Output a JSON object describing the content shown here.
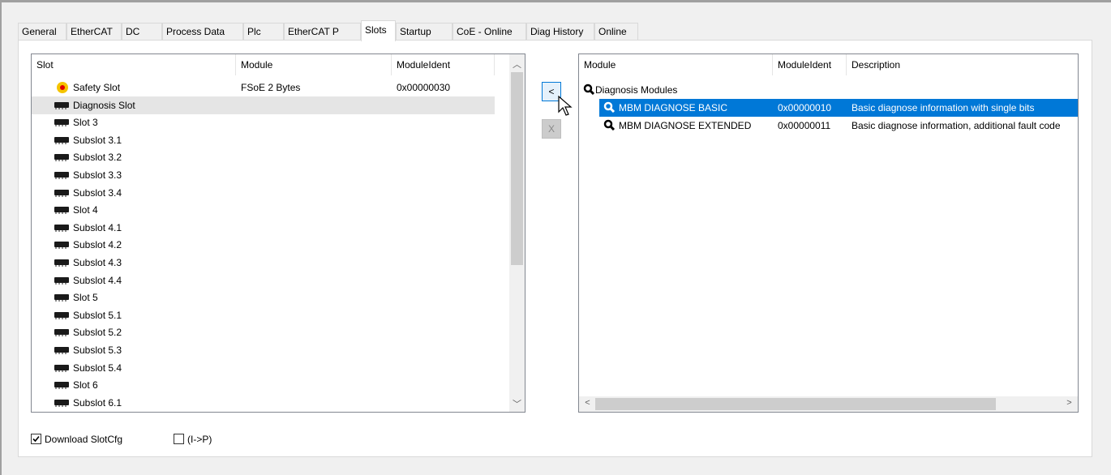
{
  "tabs": [
    "General",
    "EtherCAT",
    "DC",
    "Process Data",
    "Plc",
    "EtherCAT P",
    "Slots",
    "Startup",
    "CoE - Online",
    "Diag History",
    "Online"
  ],
  "active_tab": "Slots",
  "slot_list": {
    "columns": [
      "Slot",
      "Module",
      "ModuleIdent"
    ],
    "rows": [
      {
        "slot": "Safety Slot",
        "module": "FSoE 2 Bytes",
        "ident": "0x00000030",
        "icon": "safety-icon"
      },
      {
        "slot": "Diagnosis Slot",
        "module": "",
        "ident": "",
        "icon": "module-icon"
      },
      {
        "slot": "Slot 3",
        "module": "",
        "ident": "",
        "icon": "module-icon"
      },
      {
        "slot": "Subslot 3.1",
        "module": "",
        "ident": "",
        "icon": "module-icon"
      },
      {
        "slot": "Subslot 3.2",
        "module": "",
        "ident": "",
        "icon": "module-icon"
      },
      {
        "slot": "Subslot 3.3",
        "module": "",
        "ident": "",
        "icon": "module-icon"
      },
      {
        "slot": "Subslot 3.4",
        "module": "",
        "ident": "",
        "icon": "module-icon"
      },
      {
        "slot": "Slot 4",
        "module": "",
        "ident": "",
        "icon": "module-icon"
      },
      {
        "slot": "Subslot 4.1",
        "module": "",
        "ident": "",
        "icon": "module-icon"
      },
      {
        "slot": "Subslot 4.2",
        "module": "",
        "ident": "",
        "icon": "module-icon"
      },
      {
        "slot": "Subslot 4.3",
        "module": "",
        "ident": "",
        "icon": "module-icon"
      },
      {
        "slot": "Subslot 4.4",
        "module": "",
        "ident": "",
        "icon": "module-icon"
      },
      {
        "slot": "Slot 5",
        "module": "",
        "ident": "",
        "icon": "module-icon"
      },
      {
        "slot": "Subslot 5.1",
        "module": "",
        "ident": "",
        "icon": "module-icon"
      },
      {
        "slot": "Subslot 5.2",
        "module": "",
        "ident": "",
        "icon": "module-icon"
      },
      {
        "slot": "Subslot 5.3",
        "module": "",
        "ident": "",
        "icon": "module-icon"
      },
      {
        "slot": "Subslot 5.4",
        "module": "",
        "ident": "",
        "icon": "module-icon"
      },
      {
        "slot": "Slot 6",
        "module": "",
        "ident": "",
        "icon": "module-icon"
      },
      {
        "slot": "Subslot 6.1",
        "module": "",
        "ident": "",
        "icon": "module-icon"
      }
    ],
    "selected_row": "Diagnosis Slot"
  },
  "buttons": {
    "insert_label": "<",
    "remove_label": "X"
  },
  "module_list": {
    "columns": [
      "Module",
      "ModuleIdent",
      "Description"
    ],
    "group": "Diagnosis Modules",
    "rows": [
      {
        "module": "MBM DIAGNOSE BASIC",
        "ident": "0x00000010",
        "description": "Basic diagnose information with single bits",
        "selected": true
      },
      {
        "module": "MBM DIAGNOSE EXTENDED",
        "ident": "0x00000011",
        "description": "Basic diagnose information, additional fault code",
        "selected": false
      }
    ]
  },
  "options": {
    "download_slotcfg": {
      "label": "Download SlotCfg",
      "checked": true
    },
    "i_to_p": {
      "label": "(I->P)",
      "checked": false
    }
  },
  "colors": {
    "selection": "#0078d7",
    "row_highlight": "#e5e5e5"
  }
}
